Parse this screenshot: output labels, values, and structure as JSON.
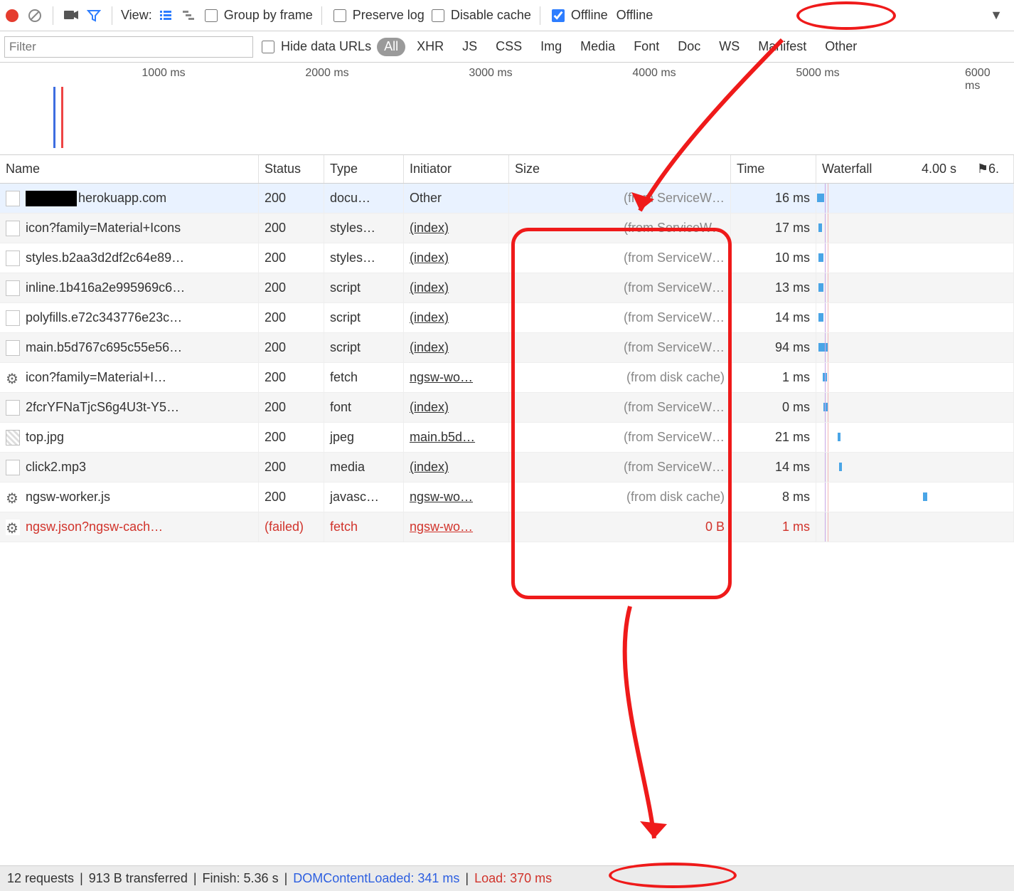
{
  "toolbar": {
    "view_label": "View:",
    "group_by_frame": "Group by frame",
    "preserve_log": "Preserve log",
    "disable_cache": "Disable cache",
    "offline_label": "Offline",
    "throttle_preset": "Offline"
  },
  "filterbar": {
    "placeholder": "Filter",
    "hide_data_urls": "Hide data URLs",
    "types": [
      "All",
      "XHR",
      "JS",
      "CSS",
      "Img",
      "Media",
      "Font",
      "Doc",
      "WS",
      "Manifest",
      "Other"
    ]
  },
  "timeline": {
    "ticks": [
      "1000 ms",
      "2000 ms",
      "3000 ms",
      "4000 ms",
      "5000 ms",
      "6000 ms"
    ]
  },
  "headers": {
    "name": "Name",
    "status": "Status",
    "type": "Type",
    "initiator": "Initiator",
    "size": "Size",
    "time": "Time",
    "waterfall": "Waterfall",
    "waterfall_scale": "4.00 s"
  },
  "rows": [
    {
      "name": "herokuapp.com",
      "status": "200",
      "type": "docu…",
      "initiator": "Other",
      "initiator_link": false,
      "size": "(from ServiceW…",
      "time": "16 ms",
      "icon": "file",
      "black": true,
      "wf_l": 1,
      "wf_w": 10,
      "failed": false
    },
    {
      "name": "icon?family=Material+Icons",
      "status": "200",
      "type": "styles…",
      "initiator": "(index)",
      "initiator_link": true,
      "size": "(from ServiceW…",
      "time": "17 ms",
      "icon": "file",
      "wf_l": 3,
      "wf_w": 5,
      "failed": false
    },
    {
      "name": "styles.b2aa3d2df2c64e89…",
      "status": "200",
      "type": "styles…",
      "initiator": "(index)",
      "initiator_link": true,
      "size": "(from ServiceW…",
      "time": "10 ms",
      "icon": "file",
      "wf_l": 3,
      "wf_w": 7,
      "failed": false
    },
    {
      "name": "inline.1b416a2e995969c6…",
      "status": "200",
      "type": "script",
      "initiator": "(index)",
      "initiator_link": true,
      "size": "(from ServiceW…",
      "time": "13 ms",
      "icon": "file",
      "wf_l": 3,
      "wf_w": 7,
      "failed": false
    },
    {
      "name": "polyfills.e72c343776e23c…",
      "status": "200",
      "type": "script",
      "initiator": "(index)",
      "initiator_link": true,
      "size": "(from ServiceW…",
      "time": "14 ms",
      "icon": "file",
      "wf_l": 3,
      "wf_w": 7,
      "failed": false
    },
    {
      "name": "main.b5d767c695c55e56…",
      "status": "200",
      "type": "script",
      "initiator": "(index)",
      "initiator_link": true,
      "size": "(from ServiceW…",
      "time": "94 ms",
      "icon": "file",
      "wf_l": 3,
      "wf_w": 14,
      "failed": false
    },
    {
      "name": "icon?family=Material+I…",
      "status": "200",
      "type": "fetch",
      "initiator": "ngsw-wo…",
      "initiator_link": true,
      "size": "(from disk cache)",
      "time": "1 ms",
      "icon": "gear",
      "wf_l": 9,
      "wf_w": 6,
      "failed": false
    },
    {
      "name": "2fcrYFNaTjcS6g4U3t-Y5…",
      "status": "200",
      "type": "font",
      "initiator": "(index)",
      "initiator_link": true,
      "size": "(from ServiceW…",
      "time": "0 ms",
      "icon": "file",
      "wf_l": 10,
      "wf_w": 6,
      "failed": false
    },
    {
      "name": "top.jpg",
      "status": "200",
      "type": "jpeg",
      "initiator": "main.b5d…",
      "initiator_link": true,
      "size": "(from ServiceW…",
      "time": "21 ms",
      "icon": "img",
      "wf_l": 30,
      "wf_w": 4,
      "failed": false
    },
    {
      "name": "click2.mp3",
      "status": "200",
      "type": "media",
      "initiator": "(index)",
      "initiator_link": true,
      "size": "(from ServiceW…",
      "time": "14 ms",
      "icon": "file",
      "wf_l": 32,
      "wf_w": 4,
      "failed": false
    },
    {
      "name": "ngsw-worker.js",
      "status": "200",
      "type": "javasc…",
      "initiator": "ngsw-wo…",
      "initiator_link": true,
      "size": "(from disk cache)",
      "time": "8 ms",
      "icon": "gear",
      "wf_l": 150,
      "wf_w": 6,
      "failed": false
    },
    {
      "name": "ngsw.json?ngsw-cach…",
      "status": "(failed)",
      "type": "fetch",
      "initiator": "ngsw-wo…",
      "initiator_link": true,
      "size": "0 B",
      "time": "1 ms",
      "icon": "gear",
      "wf_l": 0,
      "wf_w": 0,
      "failed": true
    }
  ],
  "status": {
    "requests": "12 requests",
    "transferred": "913 B transferred",
    "finish": "Finish: 5.36 s",
    "dcl": "DOMContentLoaded: 341 ms",
    "load": "Load: 370 ms"
  }
}
